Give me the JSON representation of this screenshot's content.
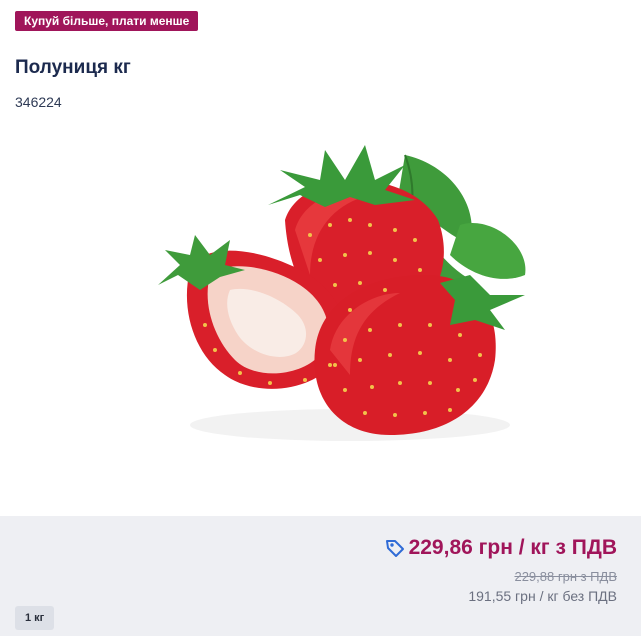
{
  "promo_badge": "Купуй більше, плати менше",
  "product": {
    "name": "Полуниця кг",
    "sku": "346224",
    "image_icon": "strawberry-image"
  },
  "pricing": {
    "price_with_vat": "229,86 грн / кг з ПДВ",
    "old_price": "229,88 грн з ПДВ",
    "price_without_vat": "191,55 грн / кг без ПДВ",
    "tag_icon": "price-tag-icon"
  },
  "unit": "1 кг",
  "colors": {
    "accent": "#a0155a",
    "title": "#1c2a4e",
    "tag_icon": "#2f6bd6",
    "footer_bg": "#eeeff3"
  }
}
